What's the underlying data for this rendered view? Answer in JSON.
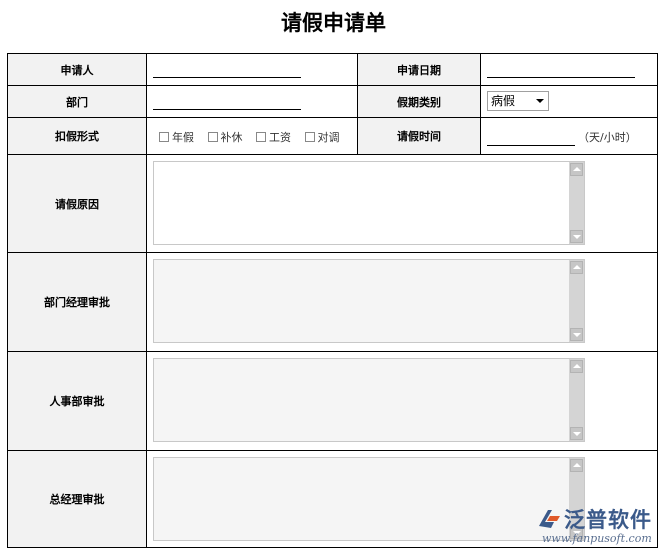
{
  "title": "请假申请单",
  "fields": {
    "applicant_label": "申请人",
    "apply_date_label": "申请日期",
    "department_label": "部门",
    "leave_type_label": "假期类别",
    "leave_type_value": "病假",
    "deduct_label": "扣假形式",
    "deduct_options": [
      "年假",
      "补休",
      "工资",
      "对调"
    ],
    "leave_time_label": "请假时间",
    "leave_time_unit": "（天/小时）",
    "reason_label": "请假原因",
    "dept_manager_label": "部门经理审批",
    "hr_label": "人事部审批",
    "gm_label": "总经理审批"
  },
  "watermark": {
    "brand": "泛普软件",
    "url": "www.fanpusoft.com",
    "logo": "fanpu-logo-icon"
  },
  "colors": {
    "label_bg": "#f2f2f2",
    "border": "#000000",
    "brand": "#3b5a8a"
  }
}
